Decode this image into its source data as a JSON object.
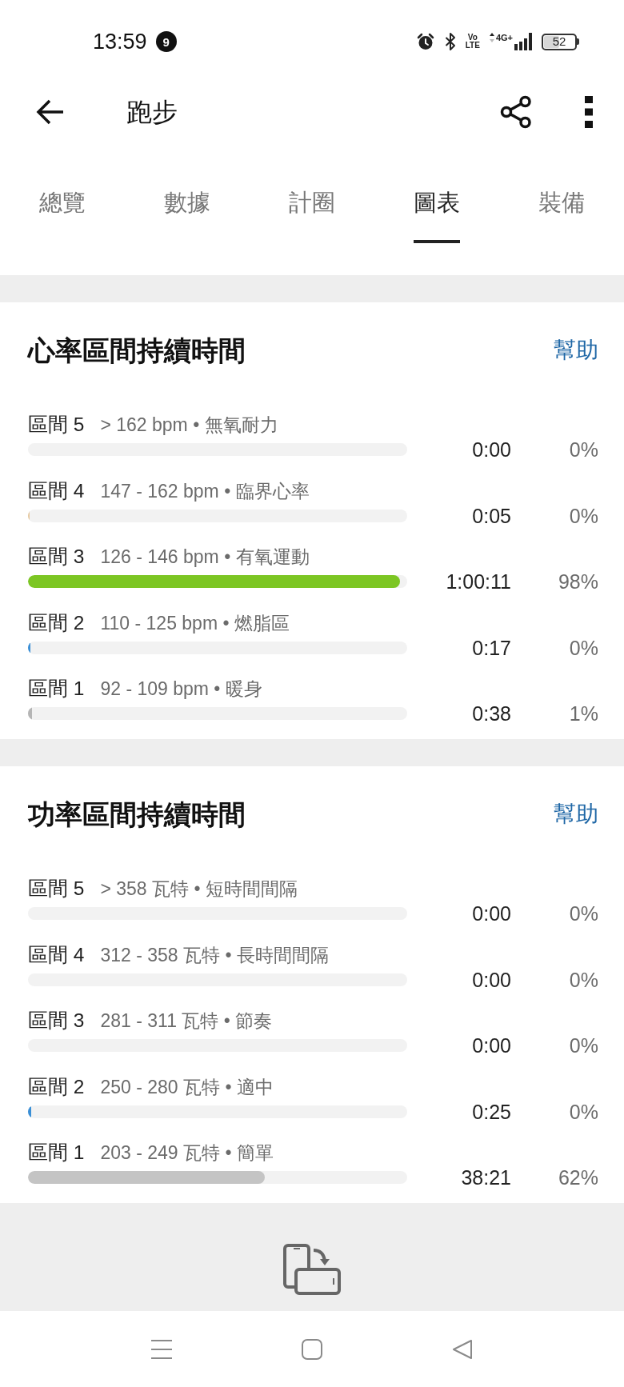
{
  "status_bar": {
    "time": "13:59",
    "notification_count": "9",
    "volte_label": [
      "Vo",
      "LTE"
    ],
    "network_type": "4G+",
    "battery": "52"
  },
  "toolbar": {
    "title": "跑步"
  },
  "tabs": [
    {
      "label": "總覽",
      "selected": false
    },
    {
      "label": "數據",
      "selected": false
    },
    {
      "label": "計圈",
      "selected": false
    },
    {
      "label": "圖表",
      "selected": true
    },
    {
      "label": "裝備",
      "selected": false
    }
  ],
  "sections": [
    {
      "title": "心率區間持續時間",
      "help": "幫助",
      "zones": [
        {
          "label": "區間 5",
          "range": "> 162 bpm • 無氧耐力",
          "time": "0:00",
          "percent": "0%"
        },
        {
          "label": "區間 4",
          "range": "147 - 162 bpm • 臨界心率",
          "level": 0.005,
          "color": "#e6c9a0",
          "time": "0:05",
          "percent": "0%"
        },
        {
          "label": "區間 3",
          "range": "126 - 146 bpm • 有氧運動",
          "level": 0.98,
          "color": "#7cc623",
          "time": "1:00:11",
          "percent": "98%"
        },
        {
          "label": "區間 2",
          "range": "110 - 125 bpm • 燃脂區",
          "level": 0.006,
          "color": "#3a8fd6",
          "time": "0:17",
          "percent": "0%"
        },
        {
          "label": "區間 1",
          "range": "92 - 109 bpm • 暖身",
          "level": 0.01,
          "color": "#b5b5b5",
          "time": "0:38",
          "percent": "1%"
        }
      ]
    },
    {
      "title": "功率區間持續時間",
      "help": "幫助",
      "zones": [
        {
          "label": "區間 5",
          "range": "> 358 瓦特 • 短時間間隔",
          "time": "0:00",
          "percent": "0%"
        },
        {
          "label": "區間 4",
          "range": "312 - 358 瓦特 • 長時間間隔",
          "time": "0:00",
          "percent": "0%"
        },
        {
          "label": "區間 3",
          "range": "281 - 311 瓦特 • 節奏",
          "time": "0:00",
          "percent": "0%"
        },
        {
          "label": "區間 2",
          "range": "250 - 280 瓦特 • 適中",
          "level": 0.008,
          "color": "#3a8fd6",
          "time": "0:25",
          "percent": "0%"
        },
        {
          "label": "區間 1",
          "range": "203 - 249 瓦特 • 簡單",
          "level": 0.625,
          "color": "#c4c4c4",
          "time": "38:21",
          "percent": "62%"
        }
      ]
    }
  ]
}
